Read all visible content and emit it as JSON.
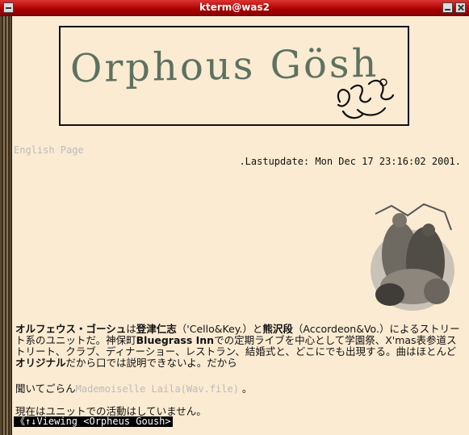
{
  "window": {
    "title": "kterm@was2"
  },
  "logo": {
    "text": "Orphous Gösh",
    "sig_glyph": "ઉ"
  },
  "nav": {
    "english_page": "English Page"
  },
  "update": {
    "text": ".Lastupdate: Mon Dec 17 23:16:02 2001."
  },
  "intro": {
    "band_name": "オルフェウス・ゴーシュ",
    "p1": "は",
    "member1": "登津仁志",
    "p2": "（'Cello&Key.）と",
    "member2": "熊沢段",
    "p3": "（Accordeon&Vo.）によるストリート系のユニットだ。神保町",
    "venue": "Bluegrass Inn",
    "p4": "での定期ライブを中心として学園祭、X'mas表参道ストリート、クラブ、ディナーショー、レストラン、結婚式と、どこにでも出現する。曲はほとんど",
    "original": "オリジナル",
    "p5": "だから口では説明できないよ。だから"
  },
  "listen": {
    "prefix": "聞いてごらん",
    "link": "Mademoiselle Laila(Wav.file)",
    "suffix": " 。"
  },
  "inactive": {
    "text": "現在はユニットでの活動はしていません。"
  },
  "status": {
    "text": "《↑↓Viewing <Orpheus Goush>"
  }
}
